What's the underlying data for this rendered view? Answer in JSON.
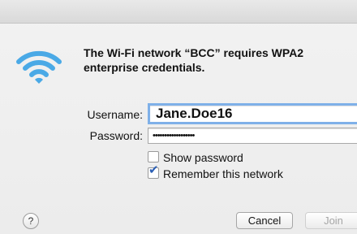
{
  "message": "The Wi-Fi network “BCC” requires WPA2 enterprise credentials.",
  "username": {
    "label": "Username:",
    "value": "Jane.Doe16"
  },
  "password": {
    "label": "Password:",
    "value": "••••••••••••••••••"
  },
  "show_password": {
    "label": "Show password",
    "checked": false
  },
  "remember_network": {
    "label": "Remember this network",
    "checked": true
  },
  "buttons": {
    "help": "?",
    "cancel": "Cancel",
    "join": "Join"
  },
  "icons": {
    "wifi": "wifi-icon"
  },
  "colors": {
    "wifi": "#4aa9e6",
    "accent": "#2b5fb5",
    "focus_ring": "#7fb0e8"
  }
}
